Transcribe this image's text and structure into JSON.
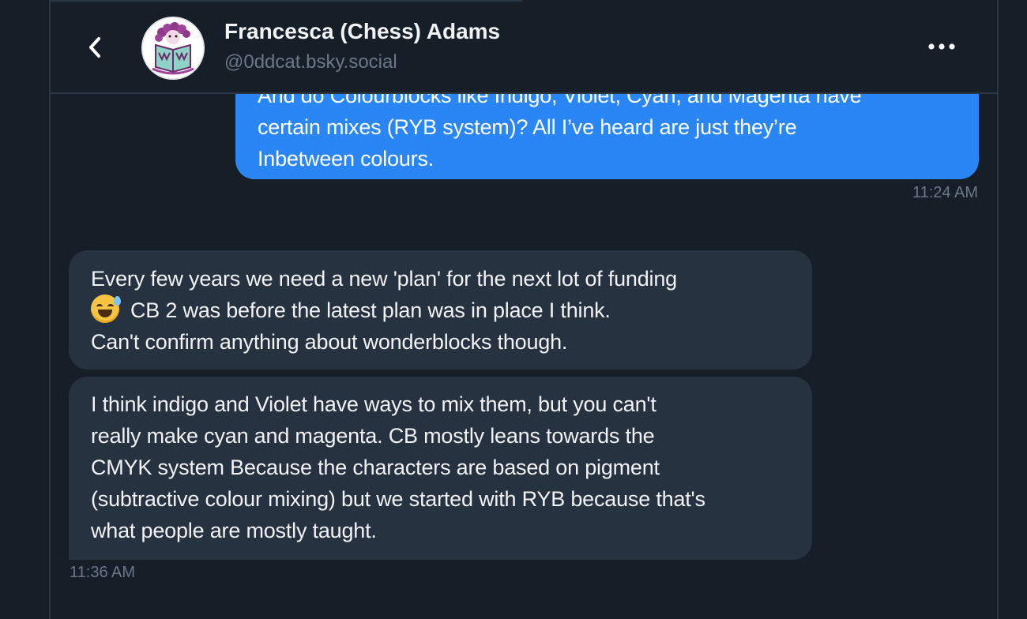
{
  "header": {
    "name": "Francesca (Chess) Adams",
    "handle": "@0ddcat.bsky.social",
    "back_icon": "chevron-left-icon",
    "more_icon": "more-horizontal-icon"
  },
  "messages": [
    {
      "sender": "me",
      "lines": [
        "And do Colourblocks like Indigo, Violet, Cyan, and Magenta have",
        "certain mixes (RYB system)? All I’ve heard are just they’re",
        "Inbetween colours."
      ],
      "time": "11:24 AM"
    },
    {
      "sender": "them",
      "lines": [
        "Every few years we need a new 'plan' for the next lot of funding",
        "CB 2 was before the latest plan was in place I think.",
        "Can't confirm anything about wonderblocks though."
      ],
      "emoji": "grinning-face-with-sweat"
    },
    {
      "sender": "them",
      "lines": [
        "I think indigo and Violet have ways to mix them, but you can't",
        "really make cyan and magenta. CB mostly leans towards the",
        "CMYK system Because the characters are based on pigment",
        "(subtractive colour mixing) but we started with RYB because that's",
        "what people are mostly taught."
      ],
      "time": "11:36 AM"
    }
  ],
  "colors": {
    "background": "#161e27",
    "my_bubble": "#2b86f5",
    "their_bubble": "#263240",
    "muted_text": "#6b7889"
  }
}
